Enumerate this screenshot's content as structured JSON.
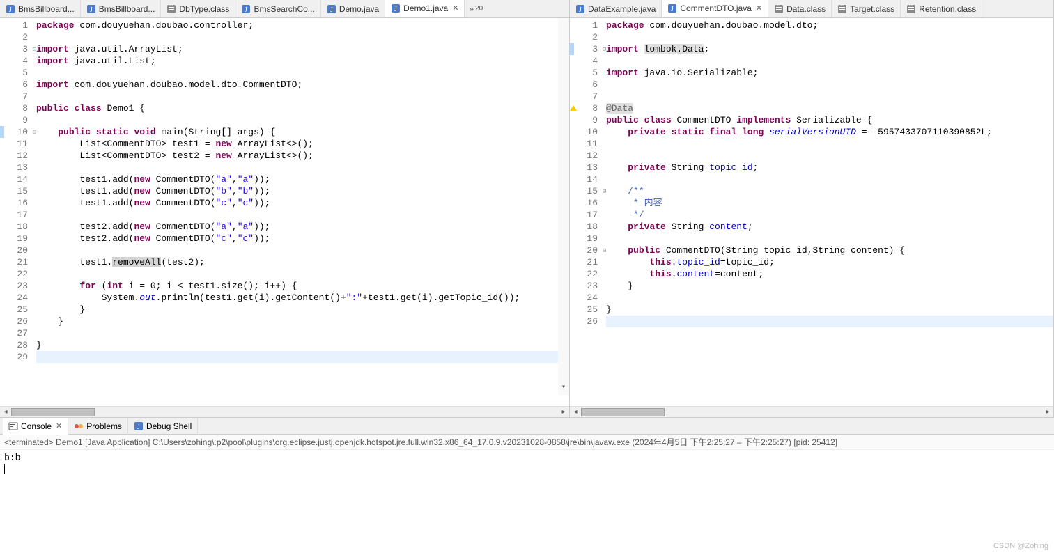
{
  "tabs_left": [
    {
      "icon": "java",
      "label": "BmsBillboard..."
    },
    {
      "icon": "java",
      "label": "BmsBillboard..."
    },
    {
      "icon": "class",
      "label": "DbType.class"
    },
    {
      "icon": "java",
      "label": "BmsSearchCo..."
    },
    {
      "icon": "java",
      "label": "Demo.java"
    },
    {
      "icon": "java",
      "label": "Demo1.java",
      "active": true,
      "close": true
    }
  ],
  "tabs_left_more": {
    "chev": "»",
    "count": "20"
  },
  "tabs_right": [
    {
      "icon": "java",
      "label": "DataExample.java"
    },
    {
      "icon": "java",
      "label": "CommentDTO.java",
      "active": true,
      "close": true
    },
    {
      "icon": "class",
      "label": "Data.class"
    },
    {
      "icon": "class",
      "label": "Target.class"
    },
    {
      "icon": "class",
      "label": "Retention.class"
    }
  ],
  "code_left": {
    "lines": [
      {
        "n": 1,
        "k": "package",
        "t": " com.douyuehan.doubao.controller;"
      },
      {
        "n": 2,
        "t": ""
      },
      {
        "n": 3,
        "fold": true,
        "k": "import",
        "t": " java.util.ArrayList;"
      },
      {
        "n": 4,
        "k": "import",
        "t": " java.util.List;"
      },
      {
        "n": 5,
        "t": ""
      },
      {
        "n": 6,
        "k": "import",
        "t": " com.douyuehan.doubao.model.dto.CommentDTO;"
      },
      {
        "n": 7,
        "t": ""
      },
      {
        "n": 8,
        "raw": "<span class='kw'>public</span> <span class='kw'>class</span> Demo1 {"
      },
      {
        "n": 9,
        "t": ""
      },
      {
        "n": 10,
        "fold": true,
        "mark": true,
        "raw": "    <span class='kw'>public</span> <span class='kw'>static</span> <span class='kw'>void</span> main(String[] args) {"
      },
      {
        "n": 11,
        "raw": "        List&lt;CommentDTO&gt; test1 = <span class='kw'>new</span> ArrayList&lt;&gt;();"
      },
      {
        "n": 12,
        "raw": "        List&lt;CommentDTO&gt; test2 = <span class='kw'>new</span> ArrayList&lt;&gt;();"
      },
      {
        "n": 13,
        "t": ""
      },
      {
        "n": 14,
        "raw": "        test1.add(<span class='kw'>new</span> CommentDTO(<span class='str'>\"a\"</span>,<span class='str'>\"a\"</span>));"
      },
      {
        "n": 15,
        "raw": "        test1.add(<span class='kw'>new</span> CommentDTO(<span class='str'>\"b\"</span>,<span class='str'>\"b\"</span>));"
      },
      {
        "n": 16,
        "raw": "        test1.add(<span class='kw'>new</span> CommentDTO(<span class='str'>\"c\"</span>,<span class='str'>\"c\"</span>));"
      },
      {
        "n": 17,
        "t": ""
      },
      {
        "n": 18,
        "raw": "        test2.add(<span class='kw'>new</span> CommentDTO(<span class='str'>\"a\"</span>,<span class='str'>\"a\"</span>));"
      },
      {
        "n": 19,
        "raw": "        test2.add(<span class='kw'>new</span> CommentDTO(<span class='str'>\"c\"</span>,<span class='str'>\"c\"</span>));"
      },
      {
        "n": 20,
        "t": ""
      },
      {
        "n": 21,
        "raw": "        test1.<span class='hl-bg'>removeAll</span>(test2);"
      },
      {
        "n": 22,
        "t": ""
      },
      {
        "n": 23,
        "raw": "        <span class='kw'>for</span> (<span class='kw'>int</span> i = 0; i &lt; test1.size(); i++) {"
      },
      {
        "n": 24,
        "raw": "            System.<span class='sfld'>out</span>.println(test1.get(i).getContent()+<span class='str'>\":\"</span>+test1.get(i).getTopic_id());"
      },
      {
        "n": 25,
        "raw": "        }"
      },
      {
        "n": 26,
        "raw": "    }"
      },
      {
        "n": 27,
        "t": ""
      },
      {
        "n": 28,
        "raw": "}"
      },
      {
        "n": 29,
        "t": "",
        "cur": true
      }
    ]
  },
  "code_right": {
    "lines": [
      {
        "n": 1,
        "k": "package",
        "t": " com.douyuehan.doubao.model.dto;"
      },
      {
        "n": 2,
        "t": ""
      },
      {
        "n": 3,
        "fold": true,
        "mark": true,
        "raw": "<span class='kw'>import</span> <span class='hl-occ'>lombok.Data</span>;"
      },
      {
        "n": 4,
        "t": ""
      },
      {
        "n": 5,
        "k": "import",
        "t": " java.io.Serializable;"
      },
      {
        "n": 6,
        "t": ""
      },
      {
        "n": 7,
        "t": ""
      },
      {
        "n": 8,
        "warn": true,
        "raw": "<span class='ann hl-occ'>@Data</span>"
      },
      {
        "n": 9,
        "raw": "<span class='kw'>public</span> <span class='kw'>class</span> CommentDTO <span class='kw'>implements</span> Serializable {"
      },
      {
        "n": 10,
        "raw": "    <span class='kw'>private</span> <span class='kw'>static</span> <span class='kw'>final</span> <span class='kw'>long</span> <span class='sfld'>serialVersionUID</span> = -5957433707110390852L;"
      },
      {
        "n": 11,
        "t": ""
      },
      {
        "n": 12,
        "t": ""
      },
      {
        "n": 13,
        "raw": "    <span class='kw'>private</span> String <span class='fld'>topic_id</span>;"
      },
      {
        "n": 14,
        "t": ""
      },
      {
        "n": 15,
        "fold": true,
        "raw": "    <span class='doc'>/**</span>"
      },
      {
        "n": 16,
        "raw": "     <span class='doc'>* 内容</span>"
      },
      {
        "n": 17,
        "raw": "     <span class='doc'>*/</span>"
      },
      {
        "n": 18,
        "raw": "    <span class='kw'>private</span> String <span class='fld'>content</span>;"
      },
      {
        "n": 19,
        "t": ""
      },
      {
        "n": 20,
        "fold": true,
        "raw": "    <span class='kw'>public</span> CommentDTO(String topic_id,String content) {"
      },
      {
        "n": 21,
        "raw": "        <span class='kw'>this</span>.<span class='fld'>topic_id</span>=topic_id;"
      },
      {
        "n": 22,
        "raw": "        <span class='kw'>this</span>.<span class='fld'>content</span>=content;"
      },
      {
        "n": 23,
        "raw": "    }"
      },
      {
        "n": 24,
        "t": ""
      },
      {
        "n": 25,
        "raw": "}"
      },
      {
        "n": 26,
        "t": "",
        "cur": true
      }
    ]
  },
  "bottom": {
    "tabs": [
      {
        "icon": "console",
        "label": "Console",
        "active": true,
        "close": true
      },
      {
        "icon": "problems",
        "label": "Problems"
      },
      {
        "icon": "debug",
        "label": "Debug Shell"
      }
    ],
    "header": "<terminated> Demo1 [Java Application] C:\\Users\\zohing\\.p2\\pool\\plugins\\org.eclipse.justj.openjdk.hotspot.jre.full.win32.x86_64_17.0.9.v20231028-0858\\jre\\bin\\javaw.exe  (2024年4月5日 下午2:25:27 – 下午2:25:27) [pid: 25412]",
    "output": "b:b"
  },
  "watermark": "CSDN @Zohing"
}
